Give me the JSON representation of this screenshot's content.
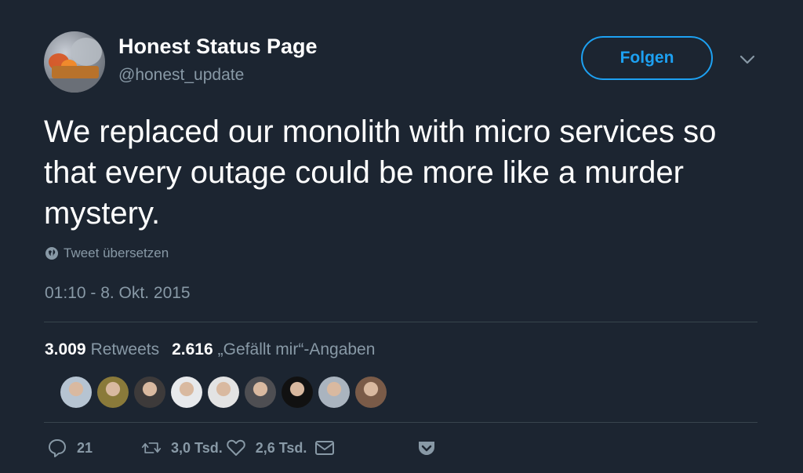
{
  "user": {
    "name": "Honest Status Page",
    "handle": "@honest_update"
  },
  "follow_button": {
    "label": "Folgen"
  },
  "tweet": {
    "text": "We replaced our monolith with micro services so that every outage could be more like a murder mystery.",
    "translate_label": "Tweet übersetzen",
    "timestamp": "01:10 - 8. Okt. 2015"
  },
  "stats": {
    "retweets_count": "3.009",
    "retweets_label": "Retweets",
    "likes_count": "2.616",
    "likes_label": "„Gefällt mir“-Angaben"
  },
  "liker_avatars": [
    {
      "color": "#b6c4d2"
    },
    {
      "color": "#8a7a3a"
    },
    {
      "color": "#3d3a3a"
    },
    {
      "color": "#e7e9ec"
    },
    {
      "color": "#e3e3e3"
    },
    {
      "color": "#4e4e52"
    },
    {
      "color": "#111111"
    },
    {
      "color": "#aab4bf"
    },
    {
      "color": "#7a5b48"
    }
  ],
  "actions": {
    "reply_count": "21",
    "retweet_count": "3,0 Tsd.",
    "like_count": "2,6 Tsd."
  },
  "colors": {
    "background": "#1c2531",
    "accent": "#1da1f2",
    "muted": "#8899a6"
  }
}
